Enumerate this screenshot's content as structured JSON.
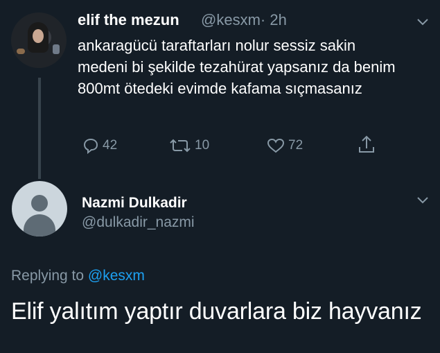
{
  "tweet": {
    "author_name": "elif the mezun",
    "handle": "@kesxm",
    "time": "· 2h",
    "text": "ankaragücü taraftarları nolur sessiz sakin medeni bi şekilde tezahürat yapsanız da benim 800mt ötedeki evimde kafama sıçmasanız",
    "replies": "42",
    "retweets": "10",
    "likes": "72"
  },
  "reply": {
    "author_name": "Nazmi Dulkadir",
    "handle": "@dulkadir_nazmi",
    "replying_prefix": "Replying to",
    "replying_mention": "@kesxm",
    "text": "Elif yalıtım yaptır duvarlara biz hayvanız"
  },
  "colors": {
    "background": "#141d26",
    "secondary_text": "#8899a6",
    "link": "#1da1f2"
  }
}
